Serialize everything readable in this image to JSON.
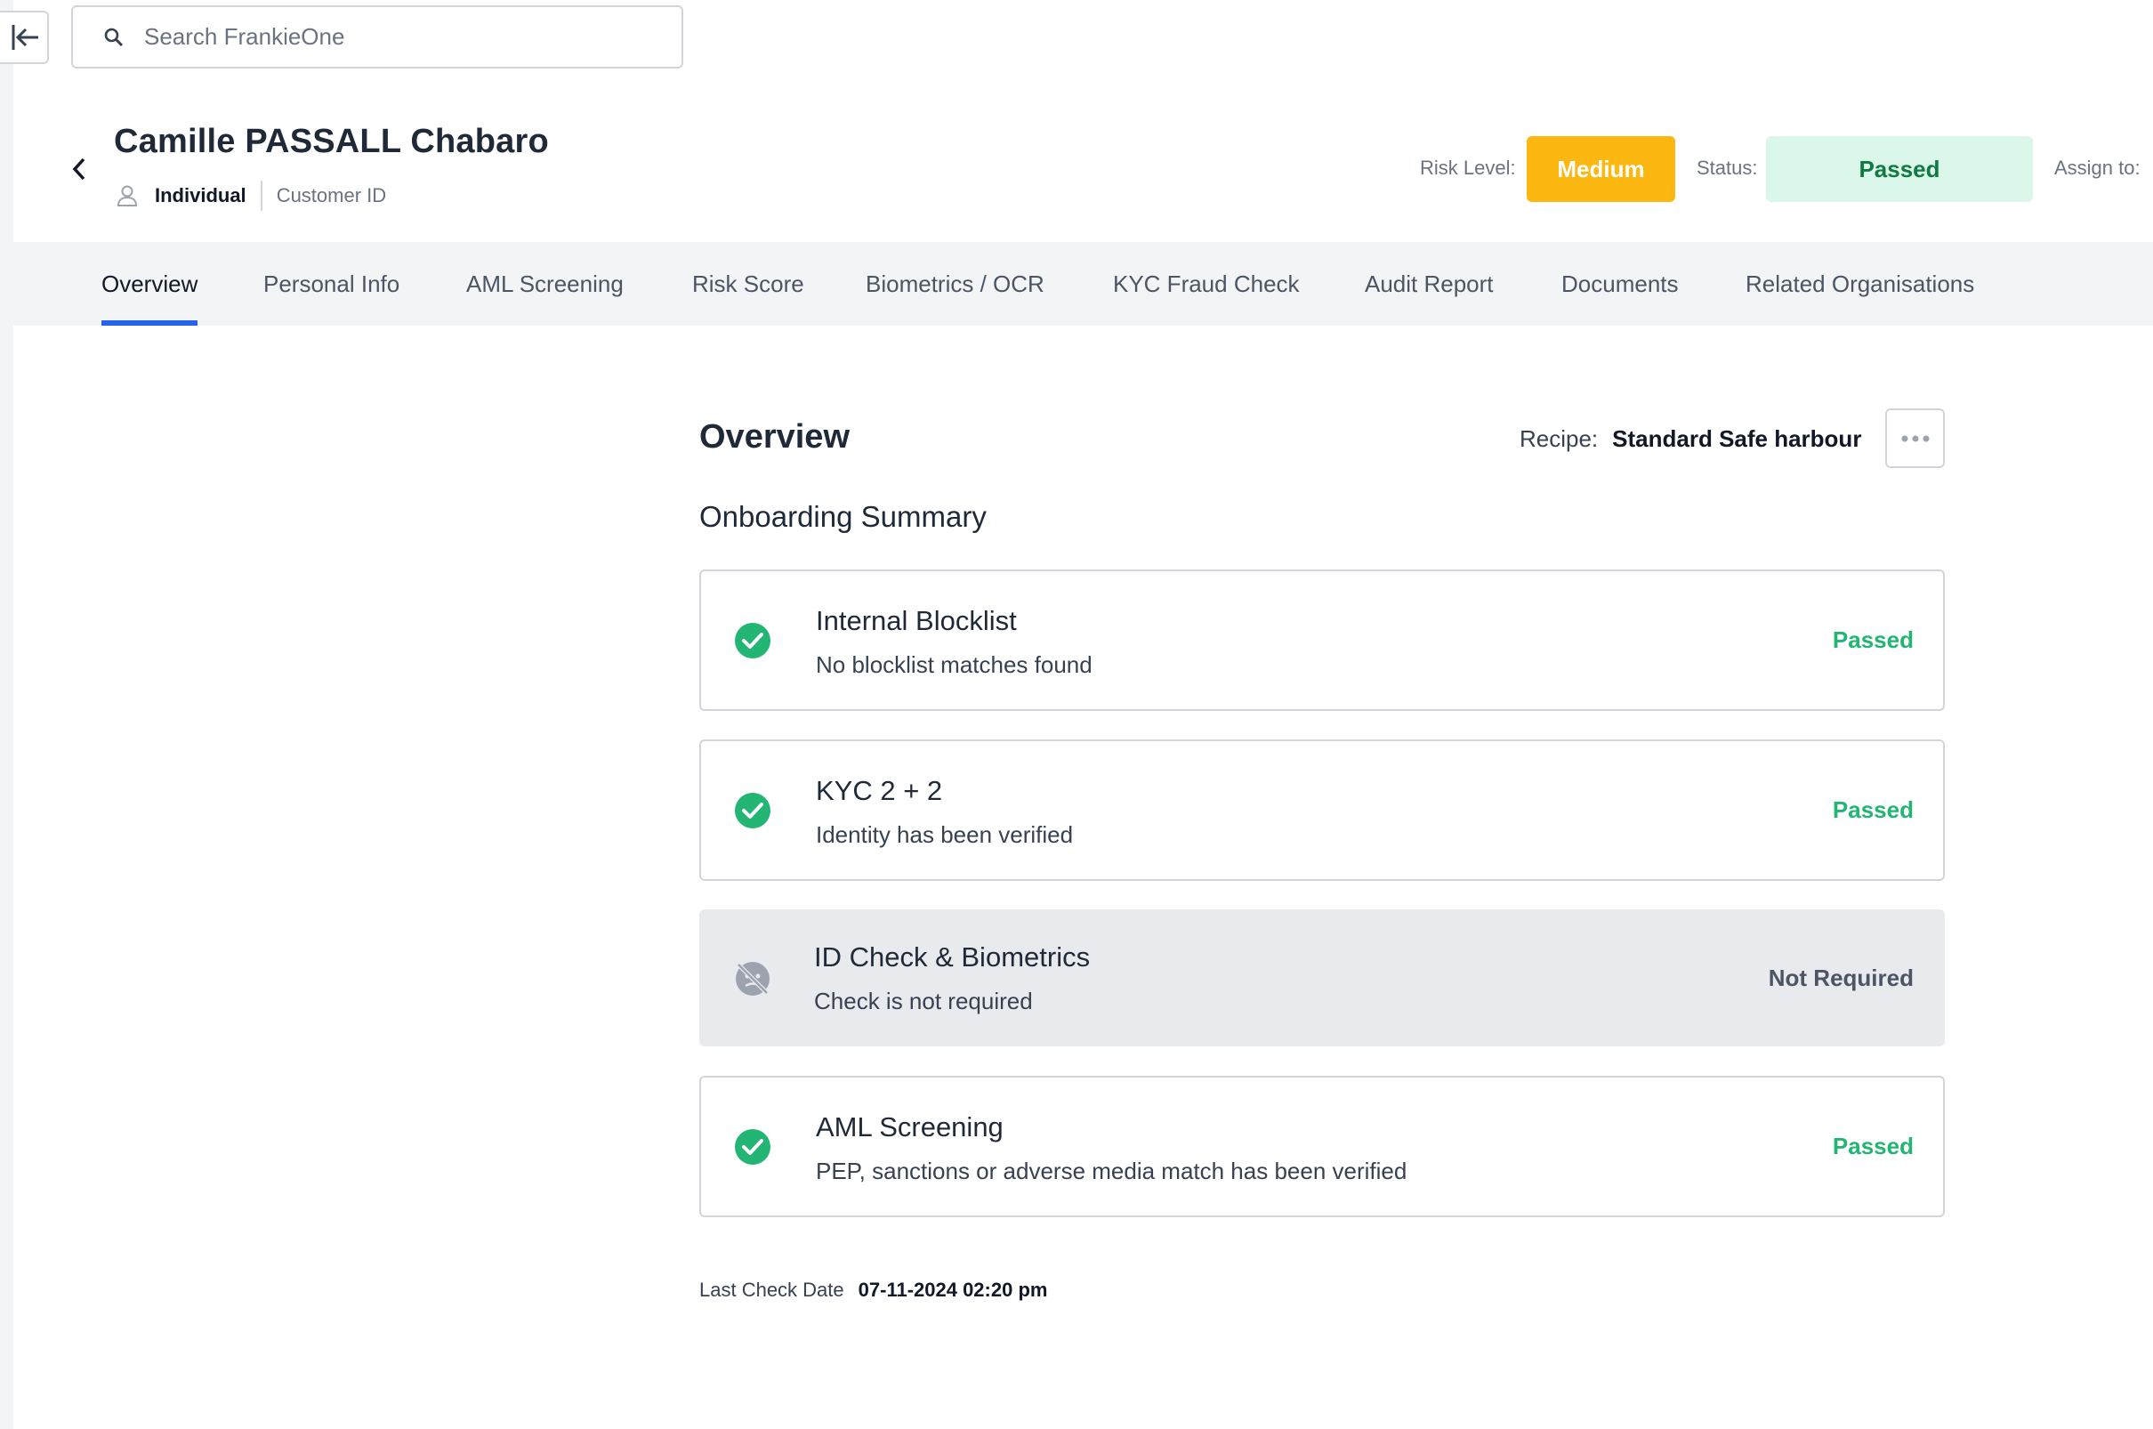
{
  "search": {
    "placeholder": "Search FrankieOne"
  },
  "entity": {
    "name": "Camille PASSALL Chabaro",
    "type": "Individual",
    "customer_id_label": "Customer ID"
  },
  "risk": {
    "label": "Risk Level:",
    "value": "Medium",
    "color": "#fcb711"
  },
  "status": {
    "label": "Status:",
    "value": "Passed",
    "color": "#dbf7e9"
  },
  "assign": {
    "label": "Assign to:"
  },
  "tabs": [
    {
      "label": "Overview",
      "active": true
    },
    {
      "label": "Personal Info"
    },
    {
      "label": "AML Screening"
    },
    {
      "label": "Risk Score"
    },
    {
      "label": "Biometrics / OCR"
    },
    {
      "label": "KYC Fraud Check"
    },
    {
      "label": "Audit Report"
    },
    {
      "label": "Documents"
    },
    {
      "label": "Related Organisations"
    }
  ],
  "overview": {
    "title": "Overview",
    "recipe_label": "Recipe:",
    "recipe_value": "Standard Safe harbour",
    "summary_title": "Onboarding Summary",
    "checks": [
      {
        "title": "Internal Blocklist",
        "description": "No blocklist matches found",
        "status": "Passed",
        "icon": "check-circle-icon"
      },
      {
        "title": "KYC 2 + 2",
        "description": "Identity has been verified",
        "status": "Passed",
        "icon": "check-circle-icon"
      },
      {
        "title": "ID Check & Biometrics",
        "description": "Check is not required",
        "status": "Not Required",
        "icon": "no-face-icon"
      },
      {
        "title": "AML Screening",
        "description": "PEP, sanctions or adverse media match has been verified",
        "status": "Passed",
        "icon": "check-circle-icon"
      }
    ],
    "last_check_label": "Last Check Date",
    "last_check_value": "07-11-2024 02:20 pm"
  },
  "colors": {
    "accent": "#2563eb",
    "passed": "#22b573",
    "medium": "#fcb711"
  }
}
